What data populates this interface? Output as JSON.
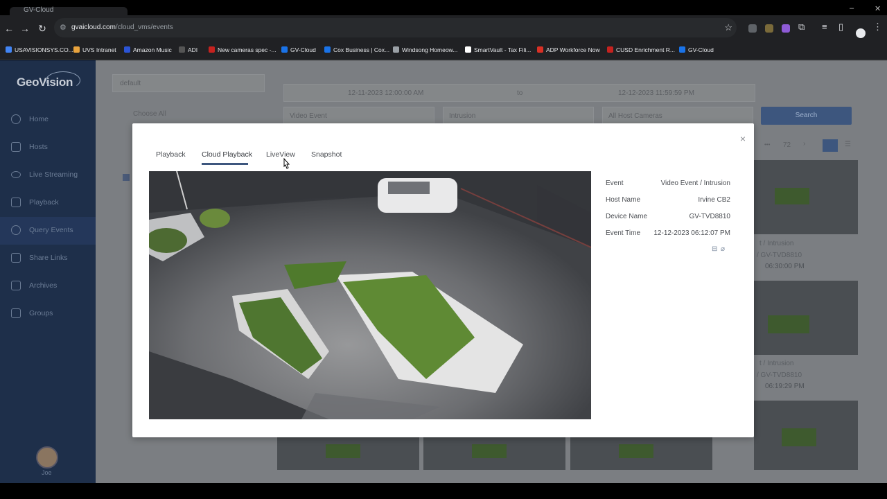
{
  "browser": {
    "tab_title": "GV-Cloud",
    "url_host": "gvaicloud.com",
    "url_path": "/cloud_vms/events",
    "bookmarks": [
      {
        "label": "USAVISIONSYS.CO...",
        "color": "#4285f4"
      },
      {
        "label": "UVS Intranet",
        "color": "#e8a33d"
      },
      {
        "label": "Amazon Music",
        "color": "#2b54d6"
      },
      {
        "label": "ADI",
        "color": "#555555"
      },
      {
        "label": "New cameras spec -...",
        "color": "#c5221f"
      },
      {
        "label": "GV-Cloud",
        "color": "#1a73e8"
      },
      {
        "label": "Cox Business | Cox...",
        "color": "#1a73e8"
      },
      {
        "label": "Windsong Homeow...",
        "color": "#9aa0a6"
      },
      {
        "label": "SmartVault - Tax Fili...",
        "color": "#ffffff"
      },
      {
        "label": "ADP Workforce Now",
        "color": "#d93025"
      },
      {
        "label": "CUSD Enrichment R...",
        "color": "#c5221f"
      },
      {
        "label": "GV-Cloud",
        "color": "#1a73e8"
      }
    ]
  },
  "sidebar": {
    "logo": "GeoVision",
    "items": [
      {
        "label": "Home"
      },
      {
        "label": "Hosts"
      },
      {
        "label": "Live Streaming"
      },
      {
        "label": "Playback"
      },
      {
        "label": "Query Events"
      },
      {
        "label": "Share Links"
      },
      {
        "label": "Archives"
      },
      {
        "label": "Groups"
      }
    ],
    "user": "Joe"
  },
  "filters": {
    "group_select": "default",
    "choose_all": "Choose All",
    "start_time": "12-11-2023 12:00:00 AM",
    "to": "to",
    "end_time": "12-12-2023 11:59:59 PM",
    "event_type": "Video Event",
    "event_subtype": "Intrusion",
    "cameras": "All Host Cameras",
    "search": "Search",
    "page_ellipsis": "•••",
    "page_number": "72"
  },
  "results": [
    {
      "event": "t / Intrusion",
      "device": "/ GV-TVD8810",
      "time": "06:30:00 PM"
    },
    {
      "event": "t / Intrusion",
      "device": "/ GV-TVD8810",
      "time": "06:19:29 PM"
    }
  ],
  "modal": {
    "tabs": [
      "Playback",
      "Cloud Playback",
      "LiveView",
      "Snapshot"
    ],
    "active_tab": "Cloud Playback",
    "details": [
      {
        "key": "Event",
        "value": "Video Event / Intrusion"
      },
      {
        "key": "Host Name",
        "value": "Irvine CB2"
      },
      {
        "key": "Device Name",
        "value": "GV-TVD8810"
      },
      {
        "key": "Event Time",
        "value": "12-12-2023 06:12:07 PM"
      }
    ],
    "close": "×"
  },
  "colors": {
    "accent": "#3d567e",
    "sidebar": "#1e2f4a"
  }
}
